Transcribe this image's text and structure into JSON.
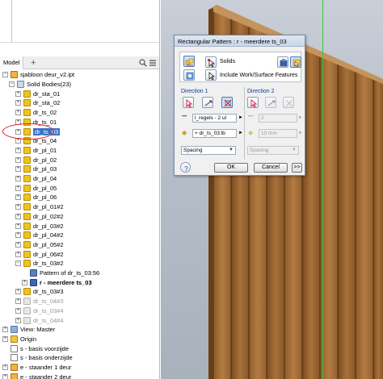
{
  "browser": {
    "tabs": [
      {
        "label": "Model"
      }
    ],
    "add_tab": "+",
    "tree": [
      {
        "label": "sjabloon deur_v2.ipt",
        "icon": "part-icon",
        "expander": "minus",
        "indent": 0,
        "style": "normal"
      },
      {
        "label": "Solid Bodies(23)",
        "icon": "solid-bodies-icon",
        "expander": "minus",
        "indent": 1,
        "style": "normal"
      },
      {
        "label": "dr_sta_01",
        "icon": "solid-body-icon",
        "expander": "plus",
        "indent": 2,
        "style": "normal"
      },
      {
        "label": "dr_sta_02",
        "icon": "solid-body-icon",
        "expander": "plus",
        "indent": 2,
        "style": "normal"
      },
      {
        "label": "dr_ts_02",
        "icon": "solid-body-icon",
        "expander": "plus",
        "indent": 2,
        "style": "normal"
      },
      {
        "label": "dr_ts_01",
        "icon": "solid-body-icon",
        "expander": "plus",
        "indent": 2,
        "style": "normal"
      },
      {
        "label": "dr_ts_03",
        "icon": "solid-body-icon",
        "expander": "plus",
        "indent": 2,
        "style": "selected"
      },
      {
        "label": "dr_ts_04",
        "icon": "solid-body-icon",
        "expander": "plus",
        "indent": 2,
        "style": "normal"
      },
      {
        "label": "dr_pl_01",
        "icon": "solid-body-icon",
        "expander": "plus",
        "indent": 2,
        "style": "normal"
      },
      {
        "label": "dr_pl_02",
        "icon": "solid-body-icon",
        "expander": "plus",
        "indent": 2,
        "style": "normal"
      },
      {
        "label": "dr_pl_03",
        "icon": "solid-body-icon",
        "expander": "plus",
        "indent": 2,
        "style": "normal"
      },
      {
        "label": "dr_pl_04",
        "icon": "solid-body-icon",
        "expander": "plus",
        "indent": 2,
        "style": "normal"
      },
      {
        "label": "dr_pl_05",
        "icon": "solid-body-icon",
        "expander": "plus",
        "indent": 2,
        "style": "normal"
      },
      {
        "label": "dr_pl_06",
        "icon": "solid-body-icon",
        "expander": "plus",
        "indent": 2,
        "style": "normal"
      },
      {
        "label": "dr_pl_01#2",
        "icon": "solid-body-icon",
        "expander": "plus",
        "indent": 2,
        "style": "normal"
      },
      {
        "label": "dr_pl_02#2",
        "icon": "solid-body-icon",
        "expander": "plus",
        "indent": 2,
        "style": "normal"
      },
      {
        "label": "dr_pl_03#2",
        "icon": "solid-body-icon",
        "expander": "plus",
        "indent": 2,
        "style": "normal"
      },
      {
        "label": "dr_pl_04#2",
        "icon": "solid-body-icon",
        "expander": "plus",
        "indent": 2,
        "style": "normal"
      },
      {
        "label": "dr_pl_05#2",
        "icon": "solid-body-icon",
        "expander": "plus",
        "indent": 2,
        "style": "normal"
      },
      {
        "label": "dr_pl_06#2",
        "icon": "solid-body-icon",
        "expander": "plus",
        "indent": 2,
        "style": "normal"
      },
      {
        "label": "dr_ts_03#2",
        "icon": "solid-body-icon",
        "expander": "minus",
        "indent": 2,
        "style": "normal"
      },
      {
        "label": "Pattern of dr_ts_03:56",
        "icon": "pattern-icon",
        "expander": "none",
        "indent": 3,
        "style": "normal"
      },
      {
        "label": "r - meerdere ts_03",
        "icon": "rect-pattern-icon",
        "expander": "plus",
        "indent": 3,
        "style": "bold"
      },
      {
        "label": "dr_ts_03#3",
        "icon": "solid-body-icon",
        "expander": "plus",
        "indent": 2,
        "style": "normal"
      },
      {
        "label": "dr_ts_04#3",
        "icon": "solid-body-grey-icon",
        "expander": "plus",
        "indent": 2,
        "style": "dim"
      },
      {
        "label": "dr_ts_03#4",
        "icon": "solid-body-grey-icon",
        "expander": "plus",
        "indent": 2,
        "style": "dim"
      },
      {
        "label": "dr_ts_04#4",
        "icon": "solid-body-grey-icon",
        "expander": "plus",
        "indent": 2,
        "style": "dim"
      },
      {
        "label": "View: Master",
        "icon": "view-icon",
        "expander": "plus",
        "indent": 0,
        "style": "normal"
      },
      {
        "label": "Origin",
        "icon": "origin-icon",
        "expander": "plus",
        "indent": 0,
        "style": "normal"
      },
      {
        "label": "s - basis voorzijde",
        "icon": "sketch-icon",
        "expander": "none",
        "indent": 0,
        "style": "normal"
      },
      {
        "label": "s - basis onderzijde",
        "icon": "sketch-icon",
        "expander": "none",
        "indent": 0,
        "style": "normal"
      },
      {
        "label": "e - staander 1 deur",
        "icon": "extrude-icon",
        "expander": "plus",
        "indent": 0,
        "style": "normal"
      },
      {
        "label": "e - staander 2 deur",
        "icon": "extrude-icon",
        "expander": "plus",
        "indent": 0,
        "style": "normal"
      }
    ]
  },
  "dialog": {
    "title": "Rectangular Pattern : r - meerdere ts_03",
    "solids_label": "Solids",
    "include_label": "Include Work/Surface Features",
    "direction1": {
      "title": "Direction 1",
      "count": "l_regels - 2 ul",
      "spacing": "+ dr_ts_03:lb",
      "method": "Spacing"
    },
    "direction2": {
      "title": "Direction 2",
      "count": "2",
      "spacing": "10 mm",
      "method": "Spacing"
    },
    "ok_label": "OK",
    "cancel_label": "Cancel",
    "more_label": ">>",
    "help_icon": "help-icon"
  },
  "colors": {
    "selection": "#3a72c8",
    "highlight_ellipse": "#d81e1e",
    "axis_green": "#3cc23c",
    "wood": "#a0652e"
  }
}
